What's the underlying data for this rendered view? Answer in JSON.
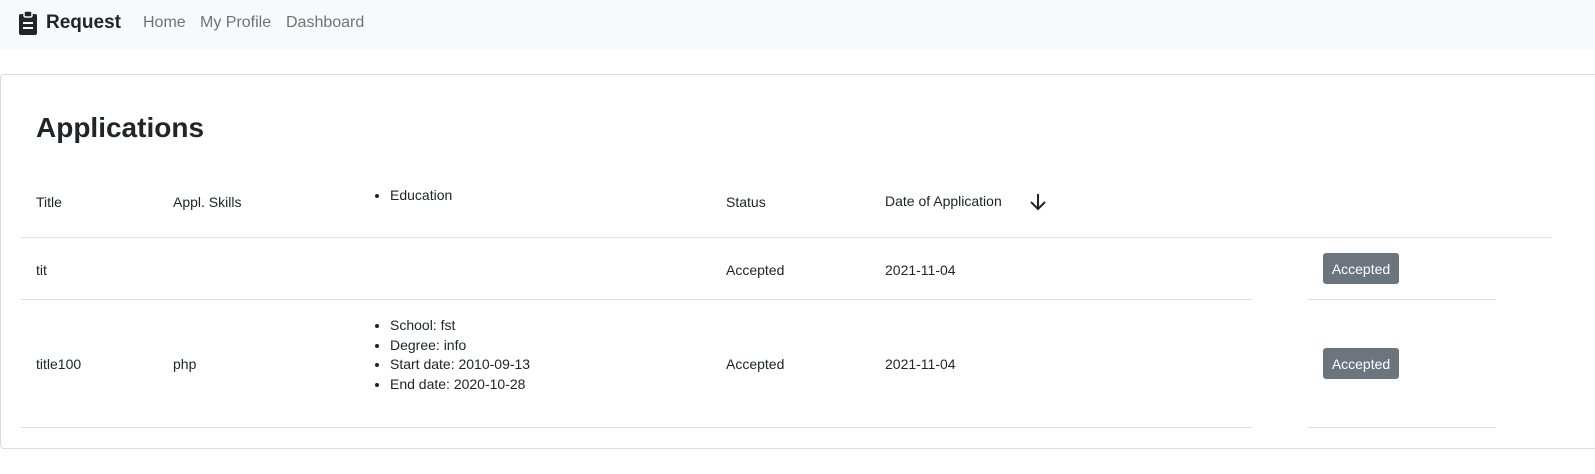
{
  "navbar": {
    "brand": "Request",
    "links": [
      "Home",
      "My Profile",
      "Dashboard"
    ]
  },
  "page": {
    "title": "Applications"
  },
  "table": {
    "headers": {
      "title": "Title",
      "skills": "Appl. Skills",
      "education": "Education",
      "status": "Status",
      "date": "Date of Application"
    },
    "sort_icon": "arrow-down-icon",
    "rows": [
      {
        "title": "tit",
        "skills": "",
        "education": [],
        "status": "Accepted",
        "date": "2021-11-04",
        "action": "Accepted"
      },
      {
        "title": "title100",
        "skills": "php",
        "education": [
          "School: fst",
          "Degree: info",
          "Start date: 2010-09-13",
          "End date: 2020-10-28"
        ],
        "status": "Accepted",
        "date": "2021-11-04",
        "action": "Accepted"
      }
    ]
  },
  "colors": {
    "navbar_bg": "#f8f9fa",
    "badge_bg": "#6c757d",
    "border": "#dee2e6"
  }
}
